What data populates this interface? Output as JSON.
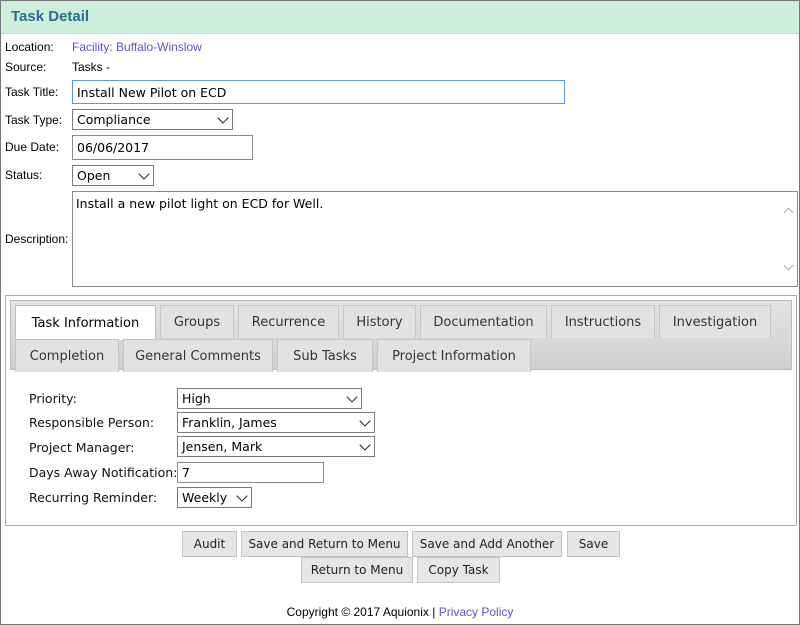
{
  "header": {
    "title": "Task Detail"
  },
  "form": {
    "location_label": "Location:",
    "location_value": "Facility: Buffalo-Winslow",
    "source_label": "Source:",
    "source_value": "Tasks -",
    "task_title_label": "Task Title:",
    "task_title_value": "Install New Pilot on ECD",
    "task_type_label": "Task Type:",
    "task_type_value": "Compliance",
    "due_date_label": "Due Date:",
    "due_date_value": "06/06/2017",
    "status_label": "Status:",
    "status_value": "Open",
    "description_label": "Description:",
    "description_value": "Install a new pilot light on ECD for Well."
  },
  "tabs": [
    {
      "label": "Task Information",
      "active": true
    },
    {
      "label": "Groups"
    },
    {
      "label": "Recurrence"
    },
    {
      "label": "History"
    },
    {
      "label": "Documentation"
    },
    {
      "label": "Instructions"
    },
    {
      "label": "Investigation"
    },
    {
      "label": "Completion"
    },
    {
      "label": "General Comments"
    },
    {
      "label": "Sub Tasks"
    },
    {
      "label": "Project Information"
    }
  ],
  "task_info": {
    "priority_label": "Priority:",
    "priority_value": "High",
    "responsible_label": "Responsible Person:",
    "responsible_value": "Franklin, James",
    "pm_label": "Project Manager:",
    "pm_value": "Jensen, Mark",
    "days_label": "Days Away Notification:",
    "days_value": "7",
    "reminder_label": "Recurring Reminder:",
    "reminder_value": "Weekly"
  },
  "buttons": {
    "audit": "Audit",
    "save_return": "Save and Return to Menu",
    "save_add": "Save and Add Another",
    "save": "Save",
    "return_menu": "Return to Menu",
    "copy_task": "Copy Task"
  },
  "footer": {
    "copyright": "Copyright © 2017 Aquionix |",
    "privacy": "Privacy Policy"
  }
}
